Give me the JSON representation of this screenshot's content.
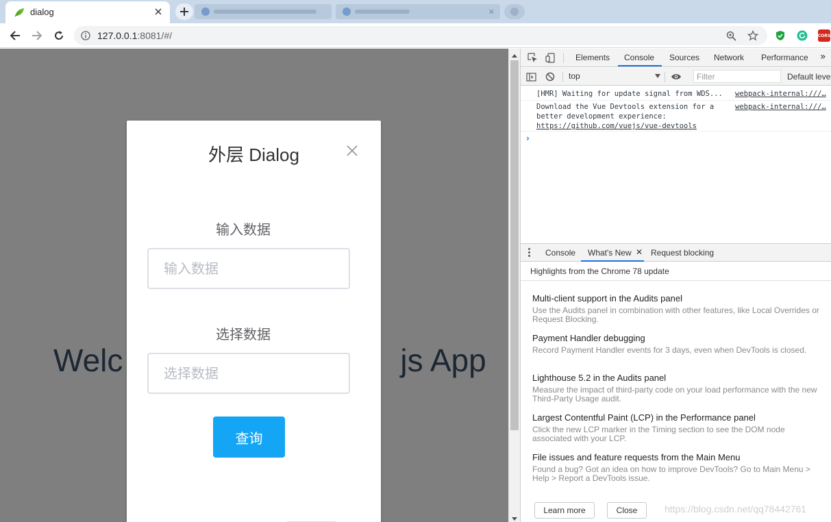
{
  "browser": {
    "active_tab_title": "dialog",
    "url_host": "127.0.0.1",
    "url_rest": ":8081/#/"
  },
  "page": {
    "welcome_left": "Welc",
    "welcome_right": "js App"
  },
  "dialog": {
    "title": "外层 Dialog",
    "input_label": "输入数据",
    "input_placeholder": "输入数据",
    "select_label": "选择数据",
    "select_placeholder": "选择数据",
    "query_button": "查询"
  },
  "devtools": {
    "tabs": [
      "Elements",
      "Console",
      "Sources",
      "Network",
      "Performance"
    ],
    "active_tab": "Console",
    "context": "top",
    "filter_placeholder": "Filter",
    "levels": "Default level",
    "messages": [
      {
        "text": "[HMR] Waiting for update signal from WDS...",
        "source": "webpack-internal:///…"
      },
      {
        "text": "Download the Vue Devtools extension for a better development experience:",
        "link": "https://github.com/vuejs/vue-devtools",
        "source": "webpack-internal:///…"
      }
    ],
    "drawer_tabs": [
      "Console",
      "What's New",
      "Request blocking"
    ],
    "drawer_active": "What's New",
    "highlights_title": "Highlights from the Chrome 78 update",
    "whats_new": [
      {
        "title": "Multi-client support in the Audits panel",
        "desc": "Use the Audits panel in combination with other features, like Local Overrides or Request Blocking."
      },
      {
        "title": "Payment Handler debugging",
        "desc": "Record Payment Handler events for 3 days, even when DevTools is closed."
      },
      {
        "title": "Lighthouse 5.2 in the Audits panel",
        "desc": "Measure the impact of third-party code on your load performance with the new Third-Party Usage audit."
      },
      {
        "title": "Largest Contentful Paint (LCP) in the Performance panel",
        "desc": "Click the new LCP marker in the Timing section to see the DOM node associated with your LCP."
      },
      {
        "title": "File issues and feature requests from the Main Menu",
        "desc": "Found a bug? Got an idea on how to improve DevTools? Go to Main Menu > Help > Report a DevTools issue."
      }
    ],
    "learn_more": "Learn more",
    "close": "Close",
    "watermark": "https://blog.csdn.net/qq78442761"
  },
  "colors": {
    "primary": "#14a6f5",
    "overlay": "#7f7f7f",
    "devtools_accent": "#1a73e8"
  }
}
